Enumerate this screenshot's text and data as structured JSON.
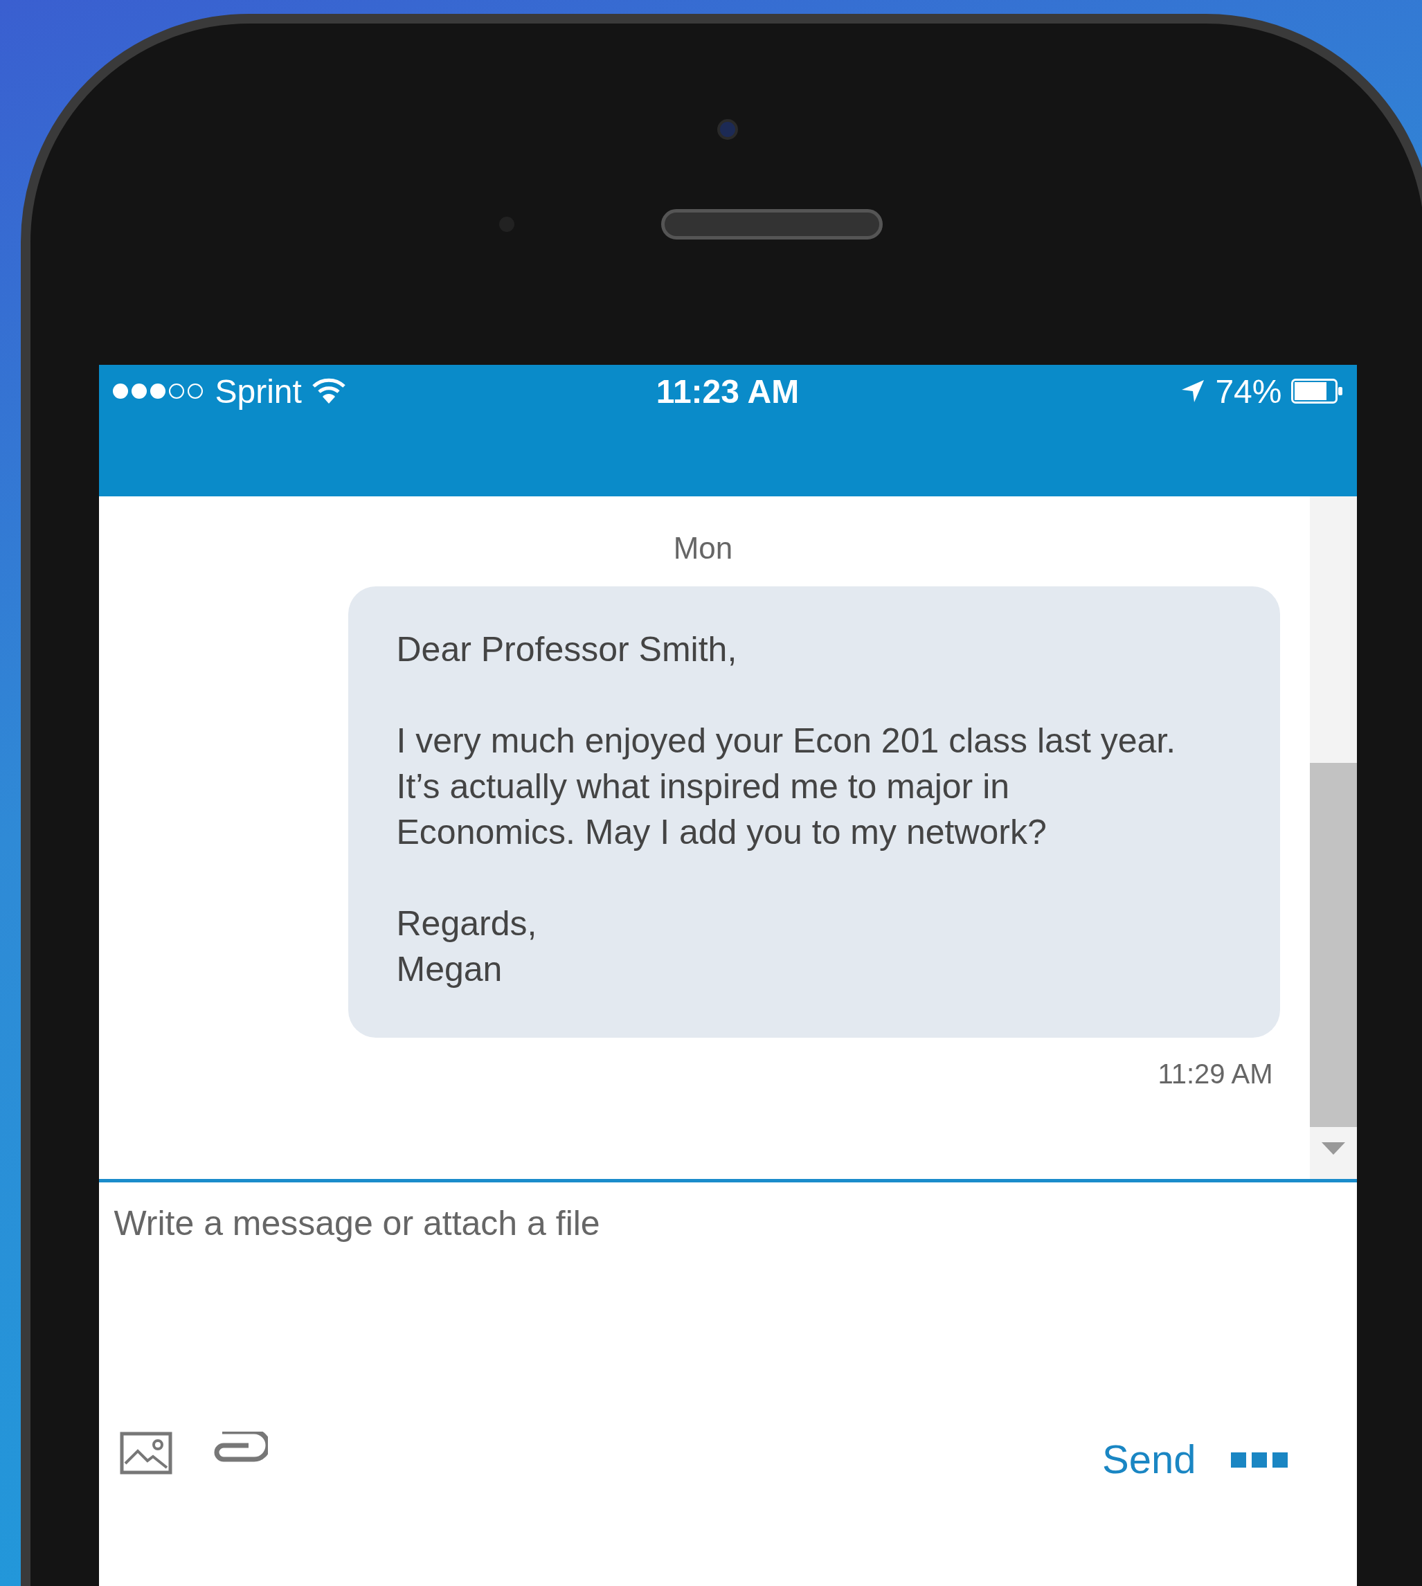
{
  "status_bar": {
    "carrier": "Sprint",
    "time": "11:23 AM",
    "battery": "74%"
  },
  "conversation": {
    "day_label": "Mon",
    "message": {
      "paragraphs": [
        [
          "Dear Professor Smith,"
        ],
        [
          "I very much enjoyed your Econ 201 class last year.",
          "It’s actually what inspired me to major in",
          "Economics. May I add you to my network?"
        ],
        [
          "Regards,",
          "Megan"
        ]
      ],
      "time": "11:29 AM"
    }
  },
  "compose": {
    "placeholder": "Write a message or attach a file",
    "send_label": "Send"
  }
}
